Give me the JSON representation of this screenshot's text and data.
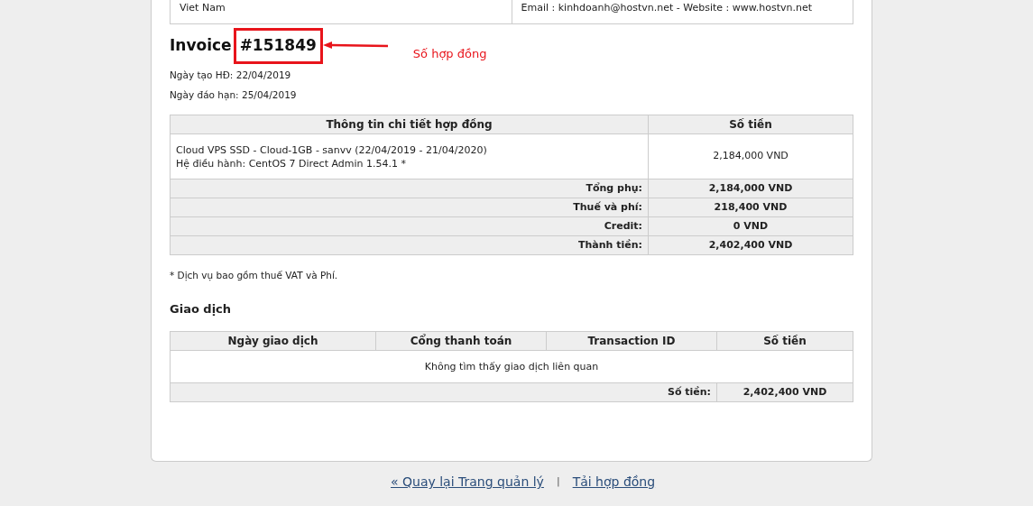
{
  "address_box": {
    "left": "Viet Nam",
    "right": "Email : kinhdoanh@hostvn.net - Website : www.hostvn.net"
  },
  "invoice": {
    "title": "Invoice",
    "number": "#151849",
    "highlighted": true,
    "created": "Ngày tạo HĐ: 22/04/2019",
    "due": "Ngày đáo hạn: 25/04/2019"
  },
  "annotation": {
    "label": "Số hợp đồng"
  },
  "items_table": {
    "columns": [
      "Thông tin chi tiết hợp đồng",
      "Số tiền"
    ],
    "rows": [
      {
        "lines": [
          "Cloud VPS SSD - Cloud-1GB - sanvv (22/04/2019 - 21/04/2020)",
          "Hệ điều hành: CentOS 7 Direct Admin 1.54.1 *"
        ],
        "amount": "2,184,000 VND"
      }
    ],
    "totals": [
      {
        "label": "Tổng phụ:",
        "value": "2,184,000 VND"
      },
      {
        "label": "Thuế và phí:",
        "value": "218,400 VND"
      },
      {
        "label": "Credit:",
        "value": "0 VND"
      },
      {
        "label": "Thành tiền:",
        "value": "2,402,400 VND"
      }
    ]
  },
  "note": "* Dịch vụ bao gồm thuế VAT và Phí.",
  "transactions": {
    "title": "Giao dịch",
    "columns": [
      "Ngày giao dịch",
      "Cổng thanh toán",
      "Transaction ID",
      "Số tiền"
    ],
    "empty_message": "Không tìm thấy giao dịch liên quan",
    "total": {
      "label": "Số tiền:",
      "value": "2,402,400 VND"
    }
  },
  "footer": {
    "links": [
      "« Quay lại Trang quản lý",
      "Tải hợp đồng"
    ],
    "separator": "|"
  }
}
